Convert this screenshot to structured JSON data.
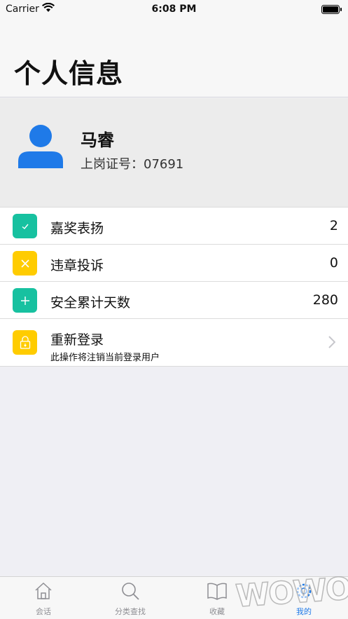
{
  "status_bar": {
    "carrier": "Carrier",
    "time": "6:08 PM"
  },
  "header": {
    "title": "个人信息"
  },
  "profile": {
    "name": "马睿",
    "cert_label": "上岗证号：07691",
    "avatar_color": "#1f7ae8"
  },
  "list": {
    "rows": [
      {
        "label": "嘉奖表扬",
        "value": "2",
        "icon": "check-icon",
        "icon_color": "#17c1a0"
      },
      {
        "label": "违章投诉",
        "value": "0",
        "icon": "x-icon",
        "icon_color": "#ffcc00"
      },
      {
        "label": "安全累计天数",
        "value": "280",
        "icon": "plus-icon",
        "icon_color": "#17c1a0"
      },
      {
        "label": "重新登录",
        "sublabel": "此操作将注销当前登录用户",
        "icon": "lock-icon",
        "icon_color": "#ffcc00"
      }
    ]
  },
  "tab_bar": {
    "tabs": [
      {
        "label": "会话",
        "icon": "home-icon"
      },
      {
        "label": "分类查找",
        "icon": "search-icon"
      },
      {
        "label": "收藏",
        "icon": "book-icon"
      },
      {
        "label": "我的",
        "icon": "gear-icon",
        "active": true
      }
    ]
  },
  "watermark": "WOWOZ"
}
